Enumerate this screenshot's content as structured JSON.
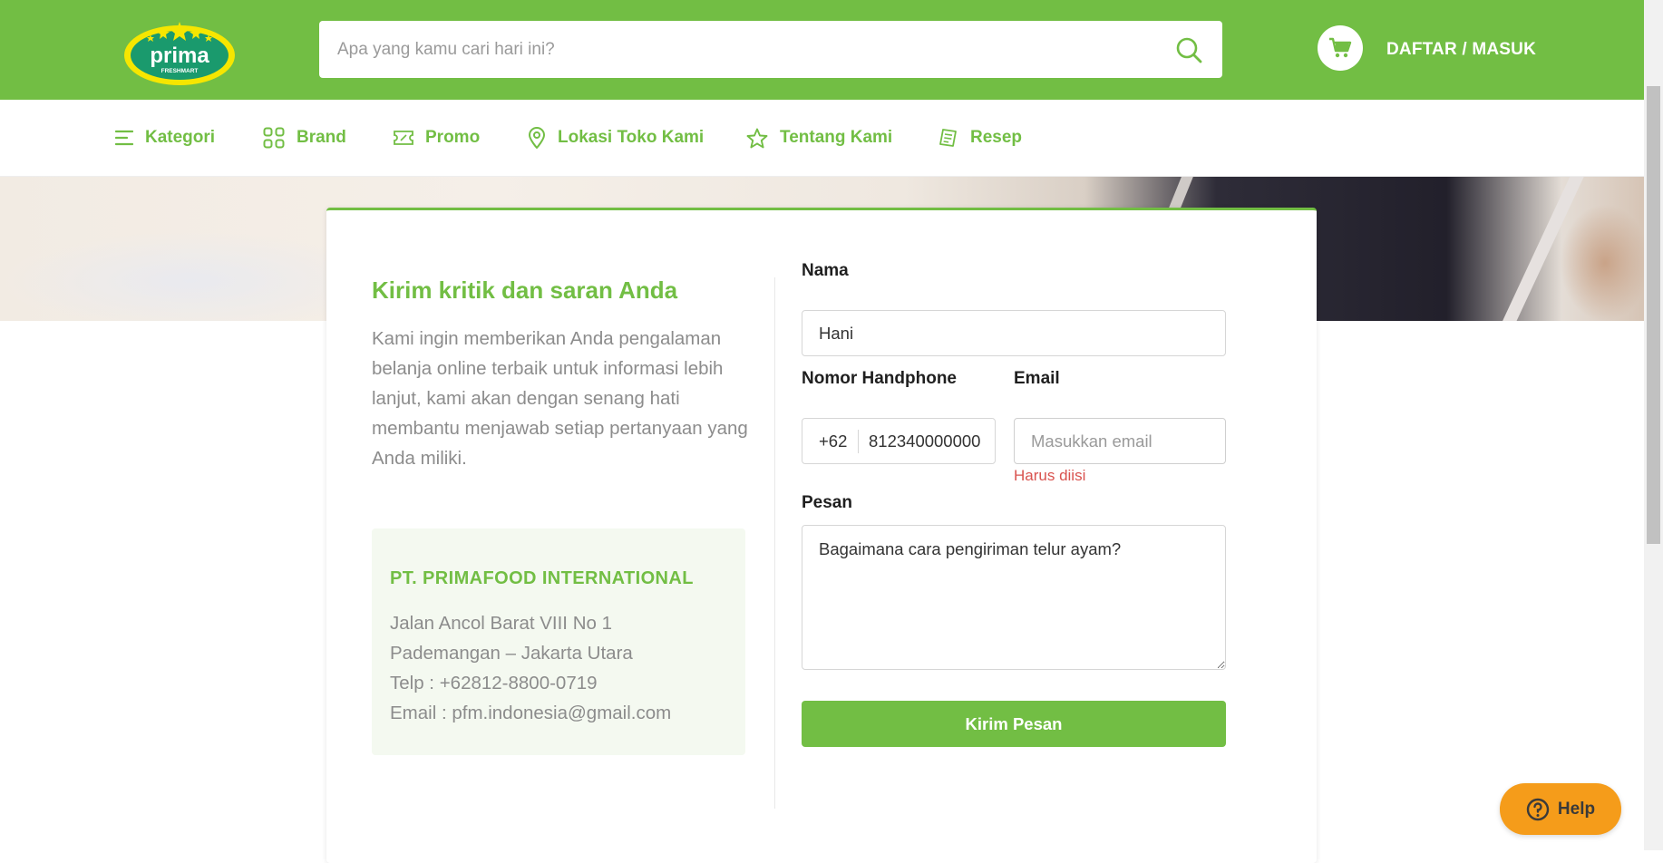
{
  "header": {
    "logo_text": "prima",
    "logo_subtext": "FRESHMART",
    "search_placeholder": "Apa yang kamu cari hari ini?",
    "auth_label": "DAFTAR / MASUK"
  },
  "nav": [
    {
      "label": "Kategori",
      "icon": "menu-icon"
    },
    {
      "label": "Brand",
      "icon": "grid-icon"
    },
    {
      "label": "Promo",
      "icon": "ticket-icon"
    },
    {
      "label": "Lokasi Toko Kami",
      "icon": "location-pin-icon"
    },
    {
      "label": "Tentang Kami",
      "icon": "star-icon"
    },
    {
      "label": "Resep",
      "icon": "receipt-icon"
    }
  ],
  "contact": {
    "title": "Kirim kritik dan saran Anda",
    "intro": "Kami ingin memberikan Anda pengalaman belanja online terbaik untuk informasi lebih lanjut, kami akan dengan senang hati membantu menjawab setiap pertanyaan yang Anda miliki.",
    "company": "PT. PRIMAFOOD INTERNATIONAL",
    "address_line1": "Jalan Ancol Barat VIII No 1",
    "address_line2": "Pademangan – Jakarta Utara",
    "phone": "Telp : +62812-8800-0719",
    "email": "Email : pfm.indonesia@gmail.com"
  },
  "form": {
    "name_label": "Nama",
    "name_value": "Hani",
    "phone_label": "Nomor Handphone",
    "phone_prefix": "+62",
    "phone_value": "812340000000",
    "email_label": "Email",
    "email_placeholder": "Masukkan email",
    "email_error": "Harus diisi",
    "message_label": "Pesan",
    "message_value": "Bagaimana cara pengiriman telur ayam?",
    "submit_label": "Kirim Pesan"
  },
  "help_label": "Help",
  "colors": {
    "brand_green": "#72be44",
    "help_orange": "#f59c1a",
    "error_red": "#d9534f"
  }
}
